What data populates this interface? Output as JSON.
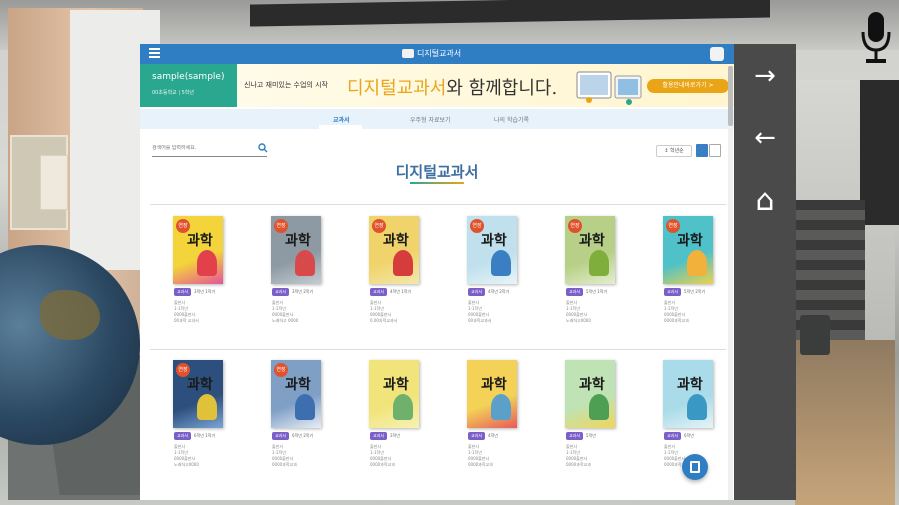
{
  "topbar": {
    "brand": "디지털교과서"
  },
  "user": {
    "name": "sample(sample)",
    "school": "00초등학교 | 5학년"
  },
  "banner": {
    "sub": "신나고 재미있는 수업의 시작",
    "main_highlight": "디지털교과서",
    "main_rest": "와 함께합니다.",
    "button": "활용안내바로가기 >"
  },
  "tabs": [
    "교과서",
    "우주형 자료보기",
    "나의 학습기록"
  ],
  "search": {
    "placeholder": "검색어를 입력하세요."
  },
  "page_title": "디지털교과서",
  "sort": {
    "label": "↕ 학년순"
  },
  "books": [
    {
      "title": "과학",
      "tag": "교과서",
      "grade": "3학년 1학기",
      "info": [
        "출판사",
        "1-1학년",
        "0000출판사",
        "00과학 교과서"
      ],
      "badge": "연장",
      "color": "#f3d43a",
      "accent": "#e2404a",
      "accent2": "#e5539a"
    },
    {
      "title": "과학",
      "tag": "교과서",
      "grade": "3학년 2학기",
      "info": [
        "출판사",
        "1-1학년",
        "0000출판사",
        "노래하고 0000"
      ],
      "badge": "연장",
      "color": "#8d9aa3",
      "accent": "#d84a4a",
      "accent2": "#c5ccd2"
    },
    {
      "title": "과학",
      "tag": "교과서",
      "grade": "4학년 1학기",
      "info": [
        "출판사",
        "1-1학년",
        "0000출판사",
        "0.00과학교과서"
      ],
      "badge": "연장",
      "color": "#f0d46b",
      "accent": "#d63c3c",
      "accent2": "#f3e7ad"
    },
    {
      "title": "과학",
      "tag": "교과서",
      "grade": "4학년 2학기",
      "info": [
        "출판사",
        "1-1학년",
        "0000출판사",
        "00과학교과서"
      ],
      "badge": "연장",
      "color": "#bfe0ec",
      "accent": "#3a7fc4",
      "accent2": "#e7f4f8"
    },
    {
      "title": "과학",
      "tag": "교과서",
      "grade": "5학년 1학기",
      "info": [
        "출판사",
        "1-1학년",
        "0000출판사",
        "노래하고0000"
      ],
      "badge": "연장",
      "color": "#b7cf86",
      "accent": "#7fae3d",
      "accent2": "#e5edcf"
    },
    {
      "title": "과학",
      "tag": "교과서",
      "grade": "5학년 2학기",
      "info": [
        "출판사",
        "1-1학년",
        "0000출판사",
        "0000과학교과"
      ],
      "badge": "연장",
      "color": "#4ec1c9",
      "accent": "#f2b13a",
      "accent2": "#eed14a"
    },
    {
      "title": "과학",
      "tag": "교과서",
      "grade": "6학년 1학기",
      "info": [
        "출판사",
        "1-1학년",
        "0000출판사",
        "노래하고0000"
      ],
      "badge": "연장",
      "color": "#2d4f7d",
      "accent": "#e0c23a",
      "accent2": "#7aa6d6"
    },
    {
      "title": "과학",
      "tag": "교과서",
      "grade": "6학년 2학기",
      "info": [
        "출판사",
        "1-1학년",
        "0000출판사",
        "0000과학교과"
      ],
      "badge": "연장",
      "color": "#7f9fc5",
      "accent": "#3d6fb0",
      "accent2": "#e8eef6"
    },
    {
      "title": "과학",
      "tag": "교과서",
      "grade": "3학년",
      "info": [
        "출판사",
        "1-1학년",
        "0000출판사",
        "0000과학교과"
      ],
      "badge": "",
      "color": "#f1e47a",
      "accent": "#6fb06c",
      "accent2": "#f7f1b4"
    },
    {
      "title": "과학",
      "tag": "교과서",
      "grade": "4학년",
      "info": [
        "출판사",
        "1-1학년",
        "0000출판사",
        "0000과학교과"
      ],
      "badge": "",
      "color": "#f3d257",
      "accent": "#5aa0c8",
      "accent2": "#e85a5a"
    },
    {
      "title": "과학",
      "tag": "교과서",
      "grade": "5학년",
      "info": [
        "출판사",
        "1-1학년",
        "0000출판사",
        "0000과학교과"
      ],
      "badge": "",
      "color": "#bfe3b4",
      "accent": "#4e9f54",
      "accent2": "#f0d65a"
    },
    {
      "title": "과학",
      "tag": "교과서",
      "grade": "6학년",
      "info": [
        "출판사",
        "1-1학년",
        "0000출판사",
        "0000과학교과"
      ],
      "badge": "",
      "color": "#a9dbe8",
      "accent": "#3a98c4",
      "accent2": "#e7f3f7"
    }
  ],
  "nav": {
    "forward": "→",
    "back": "←",
    "home": "⌂"
  },
  "colors": {
    "primary": "#2f7ec4",
    "teal": "#2aa78f",
    "accent": "#e9a516",
    "tag": "#7a5fc9"
  }
}
